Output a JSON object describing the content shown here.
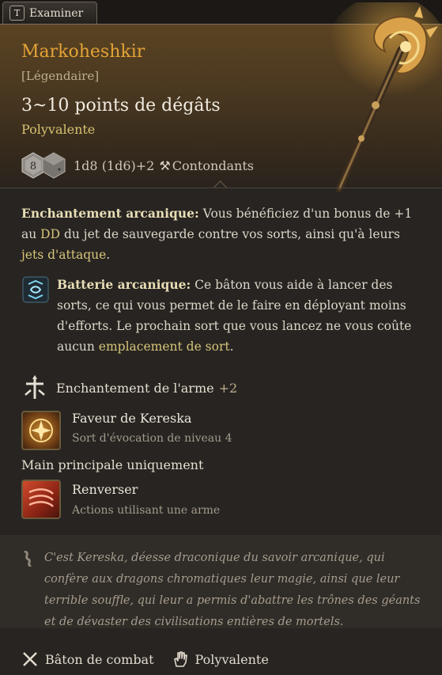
{
  "tab": {
    "key": "T",
    "label": "Examiner"
  },
  "item": {
    "name": "Markoheshkir",
    "rarity": "[Légendaire]",
    "damage": "3~10 points de dégâts",
    "property": "Polyvalente",
    "die_value": "8",
    "damage_dice": "1d8 (1d6)+2",
    "damage_type": "Contondants"
  },
  "arcane_enchantment": {
    "title": "Enchantement arcanique:",
    "text_1": " Vous bénéficiez d'un bonus de ",
    "bonus": "+1",
    "text_2": " au ",
    "dc": "DD",
    "text_3": " du jet de sauvegarde contre vos sorts, ainsi qu'à leurs ",
    "attack_rolls": "jets d'attaque",
    "text_4": "."
  },
  "arcane_battery": {
    "title": "Batterie arcanique:",
    "text_1": " Ce bâton vous aide à lancer des sorts, ce qui vous permet de le faire en déployant moins d'efforts. Le prochain sort que vous lancez ne vous coûte aucun ",
    "spell_slot": "emplacement de sort",
    "text_2": "."
  },
  "weapon_enchantment": {
    "label": "Enchantement de l'arme",
    "bonus": "+2"
  },
  "spells": [
    {
      "name": "Faveur de Kereska",
      "subtitle": "Sort d'évocation de niveau 4"
    },
    {
      "name": "Renverser",
      "subtitle": "Actions utilisant une arme"
    }
  ],
  "main_hand_only": "Main principale uniquement",
  "flavor_text": "C'est Kereska, déesse draconique du savoir arcanique, qui confère aux dragons chromatiques leur magie, ainsi que leur terrible souffle, qui leur a permis d'abattre les trônes des géants et de dévaster des civilisations entières de mortels.",
  "footer": {
    "weapon_type": "Bâton de combat",
    "property": "Polyvalente"
  },
  "icons": {
    "staff": "staff-item-icon",
    "die": "d8-die-icon",
    "damage": "hammer-icon",
    "battery": "arcane-battery-icon",
    "enchant": "weapon-enchant-icon",
    "favour": "sun-sigil-icon",
    "topple": "topple-icon",
    "flavor": "lore-icon",
    "staff_type": "crossed-staves-icon",
    "versatile": "hand-icon"
  },
  "colors": {
    "legendary": "#e3a337",
    "versatile": "#d6c271",
    "keyword": "#e7ddb5"
  }
}
